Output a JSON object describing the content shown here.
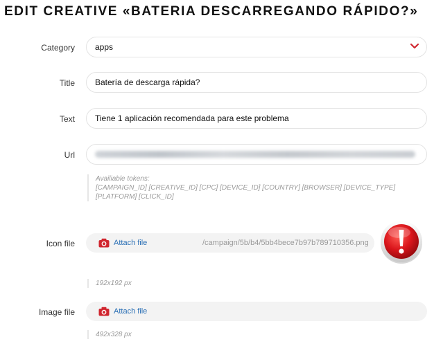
{
  "page": {
    "title": "EDIT CREATIVE «BATERIA DESCARREGANDO RÁPIDO?»"
  },
  "form": {
    "category": {
      "label": "Category",
      "value": "apps"
    },
    "title": {
      "label": "Title",
      "value": "Batería de descarga rápida?"
    },
    "text": {
      "label": "Text",
      "value": "Tiene 1 aplicación recomendada para este problema"
    },
    "url": {
      "label": "Url",
      "hint_heading": "Availiable tokens:",
      "hint_tokens_line1": "[CAMPAIGN_ID] [CREATIVE_ID] [CPC] [DEVICE_ID] [COUNTRY] [BROWSER] [DEVICE_TYPE]",
      "hint_tokens_line2": "[PLATFORM] [CLICK_ID]"
    },
    "icon_file": {
      "label": "Icon file",
      "attach_label": "Attach file",
      "current_path": "/campaign/5b/b4/5bb4bece7b97b789710356.png",
      "size_hint": "192x192 px",
      "preview_icon": "alert-exclamation-icon"
    },
    "image_file": {
      "label": "Image file",
      "attach_label": "Attach file",
      "size_hint": "492x328 px"
    }
  },
  "colors": {
    "accent_red": "#d0262f",
    "link_blue": "#2a6fb5",
    "hint_gray": "#9a9a9a"
  }
}
